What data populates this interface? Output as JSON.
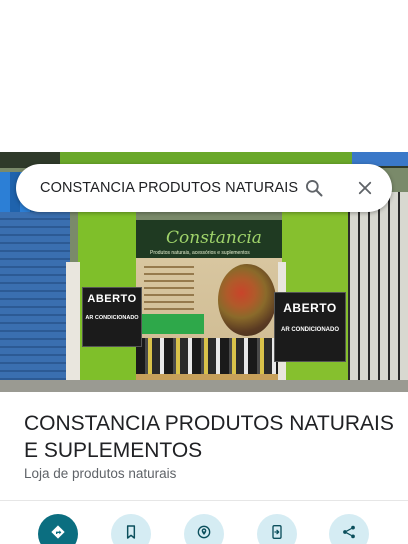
{
  "search": {
    "query": "CONSTANCIA PRODUTOS NATURAIS E SUPLEMENTOS",
    "search_icon": "search-icon",
    "clear_icon": "close-icon"
  },
  "photo": {
    "sign_logo": "Constancia",
    "sign_subtitle": "Produtos naturais, acessórios e suplementos",
    "poster_left": {
      "title": "ABERTO",
      "subtitle": "AR CONDICIONADO"
    },
    "poster_right": {
      "title": "ABERTO",
      "subtitle": "AR CONDICIONADO"
    }
  },
  "place": {
    "name": "CONSTANCIA PRODUTOS NATURAIS E SUPLEMENTOS",
    "category": "Loja de produtos naturais"
  },
  "actions": [
    {
      "icon": "directions-icon",
      "primary": true
    },
    {
      "icon": "bookmark-icon",
      "primary": false
    },
    {
      "icon": "nearby-icon",
      "primary": false
    },
    {
      "icon": "send-to-phone-icon",
      "primary": false
    },
    {
      "icon": "share-icon",
      "primary": false
    }
  ],
  "colors": {
    "primary_action": "#0b6e80",
    "secondary_action": "#d5ecf3",
    "icon_dark": "#0b4f5c"
  }
}
